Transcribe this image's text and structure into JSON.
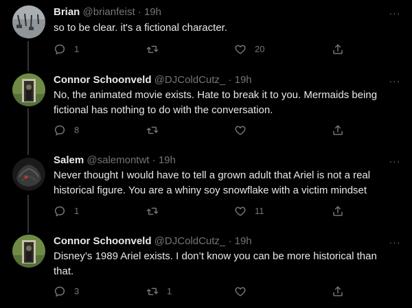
{
  "tweets": [
    {
      "name": "Brian",
      "handle": "@brianfeist",
      "sep": "·",
      "time": "19h",
      "text": "so to be clear. it's a fictional character.",
      "replies": "1",
      "retweets": "",
      "likes": "20"
    },
    {
      "name": "Connor Schoonveld",
      "handle": "@DJColdCutz_",
      "sep": "·",
      "time": "19h",
      "text": "No, the animated movie exists. Hate to break it to you. Mermaids being fictional has nothing to do with the conversation.",
      "replies": "8",
      "retweets": "",
      "likes": ""
    },
    {
      "name": "Salem",
      "handle": "@salemontwt",
      "sep": "·",
      "time": "19h",
      "text": "Never thought I would have to tell a grown adult that Ariel is not a real historical figure. You are a whiny soy snowflake with a victim mindset",
      "replies": "1",
      "retweets": "",
      "likes": "11"
    },
    {
      "name": "Connor Schoonveld",
      "handle": "@DJColdCutz_",
      "sep": "·",
      "time": "19h",
      "text": "Disney’s 1989 Ariel exists. I don’t know you can be more historical than that.",
      "replies": "3",
      "retweets": "1",
      "likes": ""
    }
  ],
  "icons": {
    "reply": "reply-icon",
    "retweet": "retweet-icon",
    "like": "heart-icon",
    "share": "share-icon",
    "more": "more-icon"
  },
  "colors": {
    "background": "#000000",
    "name": "#e7e9ea",
    "meta": "#71767b",
    "thread_line": "#333639"
  },
  "more_glyph": "···"
}
